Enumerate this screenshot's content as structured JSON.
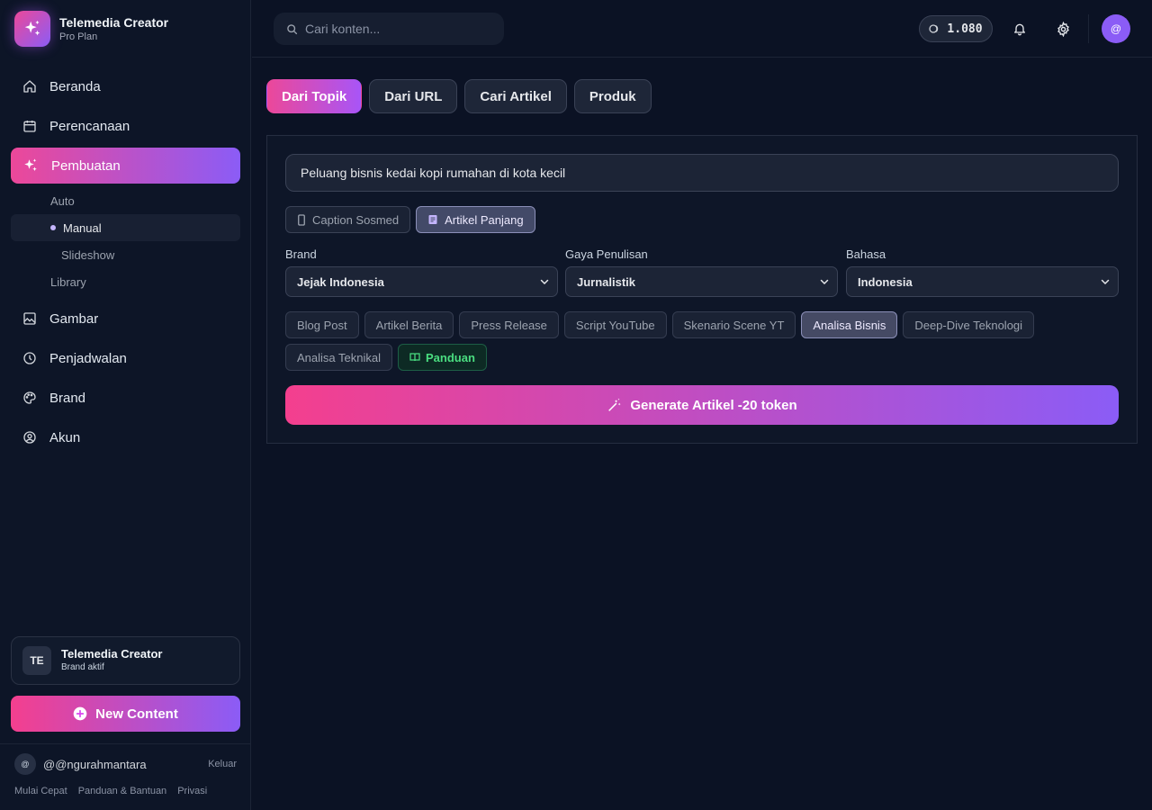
{
  "app": {
    "name": "Telemedia Creator",
    "plan": "Pro Plan"
  },
  "nav": {
    "items": [
      {
        "label": "Beranda",
        "icon": "home-icon"
      },
      {
        "label": "Perencanaan",
        "icon": "calendar-icon"
      },
      {
        "label": "Pembuatan",
        "icon": "sparkles-icon",
        "active": true
      },
      {
        "label": "Gambar",
        "icon": "image-icon"
      },
      {
        "label": "Penjadwalan",
        "icon": "clock-icon"
      },
      {
        "label": "Brand",
        "icon": "palette-icon"
      },
      {
        "label": "Akun",
        "icon": "user-circle-icon"
      }
    ],
    "sub_items": [
      {
        "label": "Auto"
      },
      {
        "label": "Manual",
        "active": true
      },
      {
        "label": "Slideshow"
      },
      {
        "label": "Library"
      }
    ]
  },
  "active_brand": {
    "initials": "TE",
    "name": "Telemedia Creator",
    "status": "Brand aktif"
  },
  "new_content_label": "New Content",
  "user": {
    "avatar": "@",
    "handle": "@@ngurahmantara",
    "logout": "Keluar"
  },
  "footer_links": [
    "Mulai Cepat",
    "Panduan & Bantuan",
    "Privasi"
  ],
  "topbar": {
    "search_placeholder": "Cari konten...",
    "tokens": "1.080",
    "avatar": "@"
  },
  "tabs": [
    {
      "label": "Dari Topik",
      "active": true
    },
    {
      "label": "Dari URL"
    },
    {
      "label": "Cari Artikel"
    },
    {
      "label": "Produk"
    }
  ],
  "form": {
    "topic_value": "Peluang bisnis kedai kopi rumahan di kota kecil",
    "formats": [
      {
        "label": "Caption Sosmed",
        "icon": "phone-icon"
      },
      {
        "label": "Artikel Panjang",
        "icon": "document-icon",
        "active": true
      }
    ],
    "brand": {
      "label": "Brand",
      "value": "Jejak Indonesia"
    },
    "style": {
      "label": "Gaya Penulisan",
      "value": "Jurnalistik"
    },
    "language": {
      "label": "Bahasa",
      "value": "Indonesia"
    },
    "types": [
      {
        "label": "Blog Post"
      },
      {
        "label": "Artikel Berita"
      },
      {
        "label": "Press Release"
      },
      {
        "label": "Script YouTube"
      },
      {
        "label": "Skenario Scene YT"
      },
      {
        "label": "Analisa Bisnis",
        "active": true
      },
      {
        "label": "Deep-Dive Teknologi"
      },
      {
        "label": "Analisa Teknikal"
      }
    ],
    "guide_label": "Panduan",
    "generate_label": "Generate Artikel -20 token"
  },
  "colors": {
    "accent_start": "#ec4899",
    "accent_end": "#8b5cf6",
    "background": "#0b1224",
    "guide_green": "#4ade80"
  }
}
